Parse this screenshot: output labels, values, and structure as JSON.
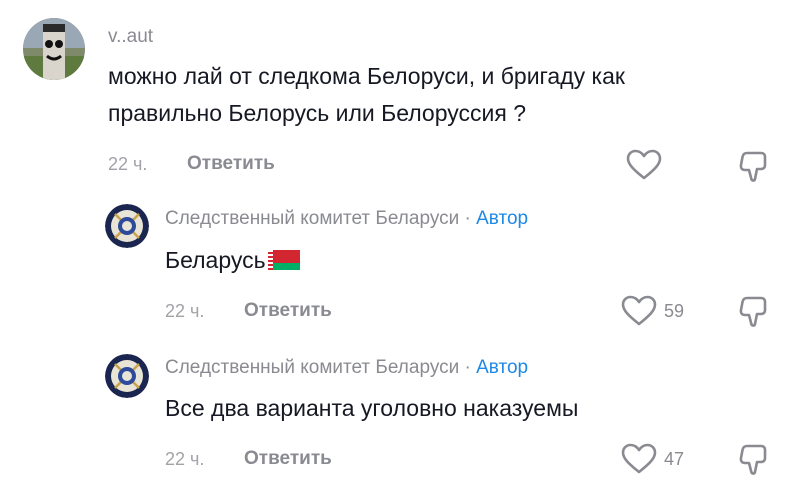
{
  "comments": [
    {
      "username": "v..aut",
      "text_line1": "можно лай от следкома Белоруси, и бригаду как",
      "text_line2": "правильно Белорусь или Белоруссия ?",
      "time": "22 ч.",
      "reply_label": "Ответить",
      "likes": ""
    },
    {
      "username": "Следственный комитет Беларуси",
      "author_separator": "·",
      "author_tag": "Автор",
      "text": "Беларусь",
      "time": "22 ч.",
      "reply_label": "Ответить",
      "likes": "59"
    },
    {
      "username": "Следственный комитет Беларуси",
      "author_separator": "·",
      "author_tag": "Автор",
      "text": "Все два варианта уголовно наказуемы",
      "time": "22 ч.",
      "reply_label": "Ответить",
      "likes": "47"
    }
  ],
  "icons": {
    "like": "heart-outline-icon",
    "dislike": "thumbs-down-outline-icon",
    "flag": "belarus-flag-icon",
    "avatar_main": "user-photo-avatar",
    "avatar_reply": "investigative-committee-emblem"
  },
  "colors": {
    "author_tag": "#1e88e5",
    "secondary_text": "#8a8b91",
    "primary_text": "#161823",
    "emblem_navy": "#1b2650"
  }
}
